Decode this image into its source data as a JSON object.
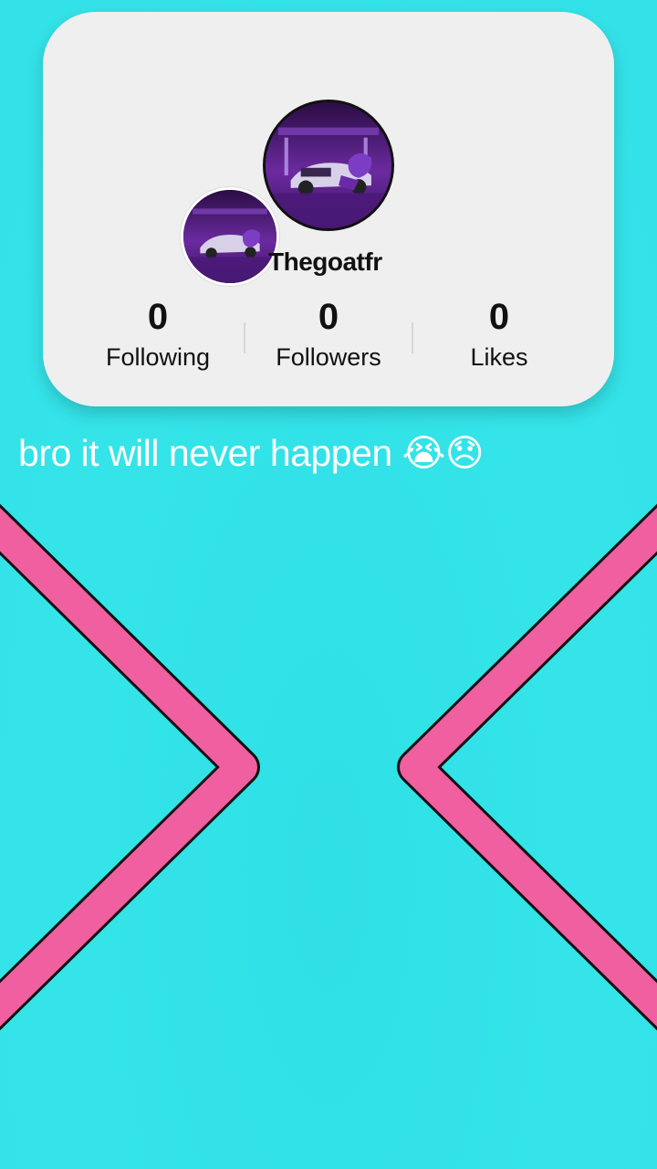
{
  "profile": {
    "username": "Thegoatfr",
    "avatar_large": "profile-avatar",
    "avatar_small": "secondary-avatar",
    "stats": [
      {
        "value": "0",
        "label": "Following"
      },
      {
        "value": "0",
        "label": "Followers"
      },
      {
        "value": "0",
        "label": "Likes"
      }
    ]
  },
  "caption": "bro it will never happen 😭😞",
  "colors": {
    "background": "#33e3e8",
    "card": "#efefef",
    "chevron_pink": "#f05fa0",
    "chevron_outline": "#111111",
    "avatar_purple": "#6a2b9a"
  },
  "icons": [
    "left-chevron-icon",
    "right-chevron-icon"
  ]
}
